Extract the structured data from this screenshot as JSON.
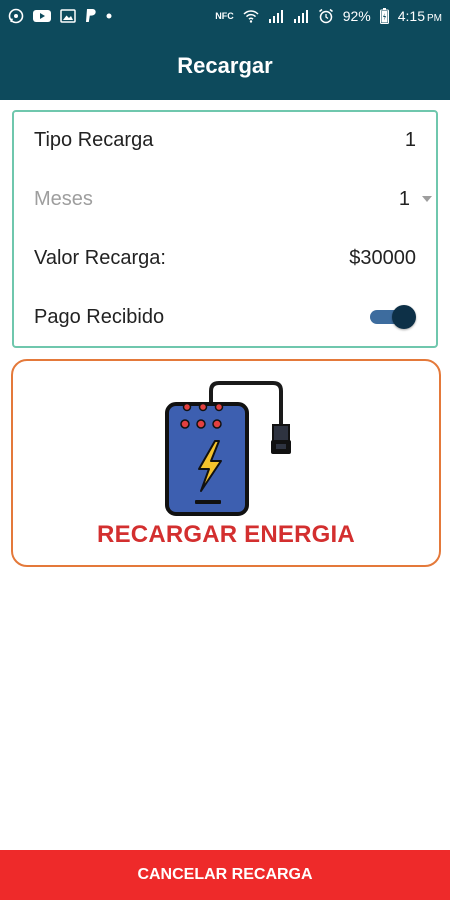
{
  "status_bar": {
    "battery_percent": "92%",
    "time": "4:15",
    "ampm": "PM",
    "nfc": "NFC",
    "icons_left": [
      "whatsapp-icon",
      "youtube-icon",
      "gallery-icon",
      "paypal-icon",
      "dot-icon"
    ],
    "icons_right": [
      "nfc-icon",
      "wifi-icon",
      "signal-icon",
      "signal-icon",
      "alarm-icon",
      "battery-icon"
    ]
  },
  "header": {
    "title": "Recargar"
  },
  "form": {
    "tipo_recarga_label": "Tipo Recarga",
    "tipo_recarga_value": "1",
    "meses_label": "Meses",
    "meses_value": "1",
    "valor_recarga_label": "Valor Recarga:",
    "valor_recarga_value": "$30000",
    "pago_recibido_label": "Pago Recibido",
    "pago_recibido_on": true
  },
  "energy": {
    "label": "RECARGAR ENERGIA"
  },
  "footer": {
    "cancel_label": "CANCELAR RECARGA"
  },
  "colors": {
    "header_bg": "#0d4a5c",
    "card_border": "#6fc7ad",
    "energy_border": "#e4793a",
    "energy_text": "#d32f2f",
    "cancel_bg": "#ee2a2a",
    "toggle_on": "#0d3047"
  }
}
